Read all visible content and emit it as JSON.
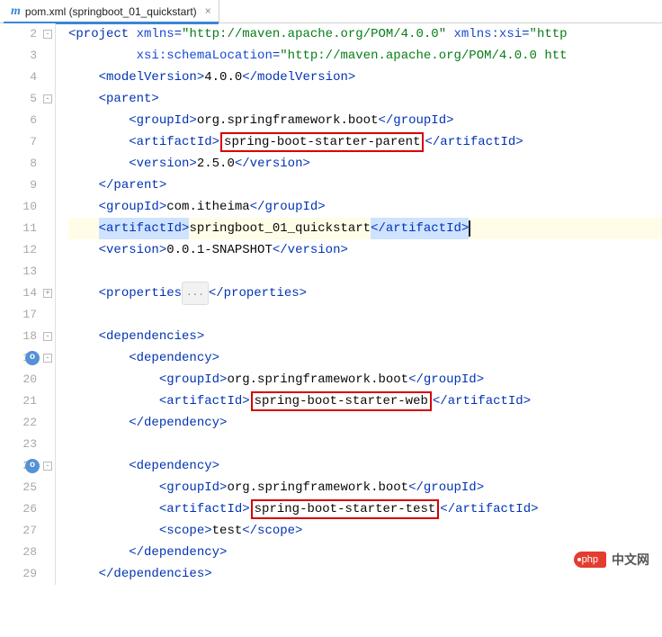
{
  "tab": {
    "icon_letter": "m",
    "label": "pom.xml (springboot_01_quickstart)",
    "close": "×"
  },
  "lines": {
    "n2": "2",
    "n3": "3",
    "n4": "4",
    "n5": "5",
    "n6": "6",
    "n7": "7",
    "n8": "8",
    "n9": "9",
    "n10": "10",
    "n11": "11",
    "n12": "12",
    "n13": "13",
    "n14": "14",
    "n17": "17",
    "n18": "18",
    "n19": "19",
    "n20": "20",
    "n21": "21",
    "n22": "22",
    "n23": "23",
    "n24": "24",
    "n25": "25",
    "n26": "26",
    "n27": "27",
    "n28": "28",
    "n29": "29"
  },
  "xml": {
    "project_open1": "<project",
    "attr_xmlns": "xmlns",
    "val_xmlns": "\"http://maven.apache.org/POM/4.0.0\"",
    "attr_xmlnsxsi": "xmlns:xsi",
    "val_xmlnsxsi_prefix": "\"http",
    "attr_schemaLoc": "xsi:schemaLocation",
    "val_schemaLoc": "\"http://maven.apache.org/POM/4.0.0 htt",
    "modelVersion_open": "<modelVersion>",
    "modelVersion_text": "4.0.0",
    "modelVersion_close": "</modelVersion>",
    "parent_open": "<parent>",
    "parent_close": "</parent>",
    "groupId_open": "<groupId>",
    "groupId_close": "</groupId>",
    "artifactId_open": "<artifactId>",
    "artifactId_close": "</artifactId>",
    "version_open": "<version>",
    "version_close": "</version>",
    "scope_open": "<scope>",
    "scope_close": "</scope>",
    "dependencies_open": "<dependencies>",
    "dependencies_close": "</dependencies>",
    "dependency_open": "<dependency>",
    "dependency_close": "</dependency>",
    "properties_open": "<properties",
    "properties_close": "</properties>",
    "dots": "...",
    "gid_spring": "org.springframework.boot",
    "aid_parent": "spring-boot-starter-parent",
    "ver_250": "2.5.0",
    "gid_itheima": "com.itheima",
    "aid_quickstart": "springboot_01_quickstart",
    "ver_snapshot": "0.0.1-SNAPSHOT",
    "aid_web": "spring-boot-starter-web",
    "aid_test": "spring-boot-starter-test",
    "scope_test": "test"
  },
  "watermark": {
    "badge": "php",
    "text": "中文网"
  }
}
